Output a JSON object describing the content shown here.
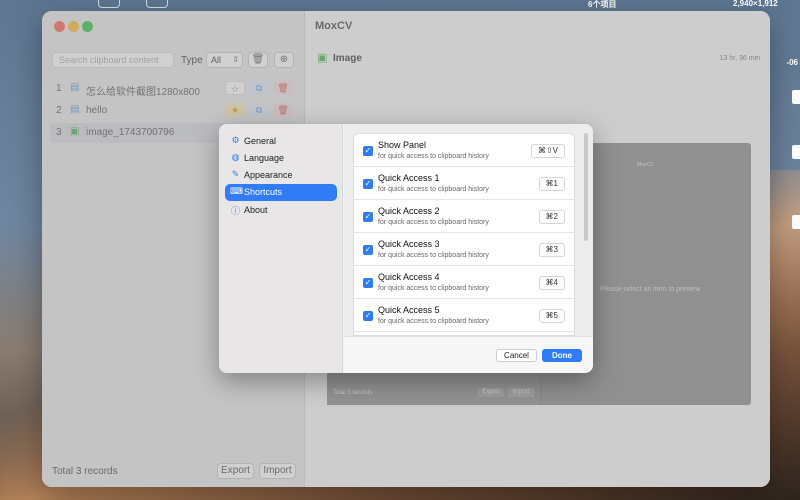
{
  "desktop": {
    "menubar_items": "6个项目",
    "menubar_resolution": "2,940×1,912",
    "side_label": "-06"
  },
  "app": {
    "title": "MoxCV",
    "search_placeholder": "Search clipboard content",
    "type_label": "Type",
    "type_value": "All",
    "items": [
      {
        "num": "1",
        "title": "怎么给软件截图1280x800",
        "icon": "doc-icon"
      },
      {
        "num": "2",
        "title": "hello",
        "icon": "doc-icon"
      },
      {
        "num": "3",
        "title": "image_1743700796",
        "icon": "image-icon"
      }
    ],
    "total": "Total 3 records",
    "export_label": "Export",
    "import_label": "Import",
    "detail_title": "Image",
    "detail_time": "13 hr, 36 min",
    "preview": {
      "app": "MoxCV",
      "message": "Please select an item to preview",
      "total": "Total 5 records",
      "export_label": "Export",
      "import_label": "Import"
    }
  },
  "settings": {
    "nav": [
      {
        "label": "General",
        "icon": "gear-icon",
        "active": false
      },
      {
        "label": "Language",
        "icon": "globe-icon",
        "active": false
      },
      {
        "label": "Appearance",
        "icon": "brush-icon",
        "active": false
      },
      {
        "label": "Shortcuts",
        "icon": "keyboard-icon",
        "active": true
      },
      {
        "label": "About",
        "icon": "info-icon",
        "active": false
      }
    ],
    "shortcuts": [
      {
        "name": "Show Panel",
        "desc": "for quick access to clipboard history",
        "key": "⌘⇧V",
        "enabled": true
      },
      {
        "name": "Quick Access 1",
        "desc": "for quick access to clipboard history",
        "key": "⌘1",
        "enabled": true
      },
      {
        "name": "Quick Access 2",
        "desc": "for quick access to clipboard history",
        "key": "⌘2",
        "enabled": true
      },
      {
        "name": "Quick Access 3",
        "desc": "for quick access to clipboard history",
        "key": "⌘3",
        "enabled": true
      },
      {
        "name": "Quick Access 4",
        "desc": "for quick access to clipboard history",
        "key": "⌘4",
        "enabled": true
      },
      {
        "name": "Quick Access 5",
        "desc": "for quick access to clipboard history",
        "key": "⌘5",
        "enabled": true
      }
    ],
    "cancel_label": "Cancel",
    "done_label": "Done"
  },
  "colors": {
    "accent": "#2f7cf6",
    "close": "#ff5f57",
    "minimize": "#febc2e",
    "zoom": "#28c840"
  }
}
